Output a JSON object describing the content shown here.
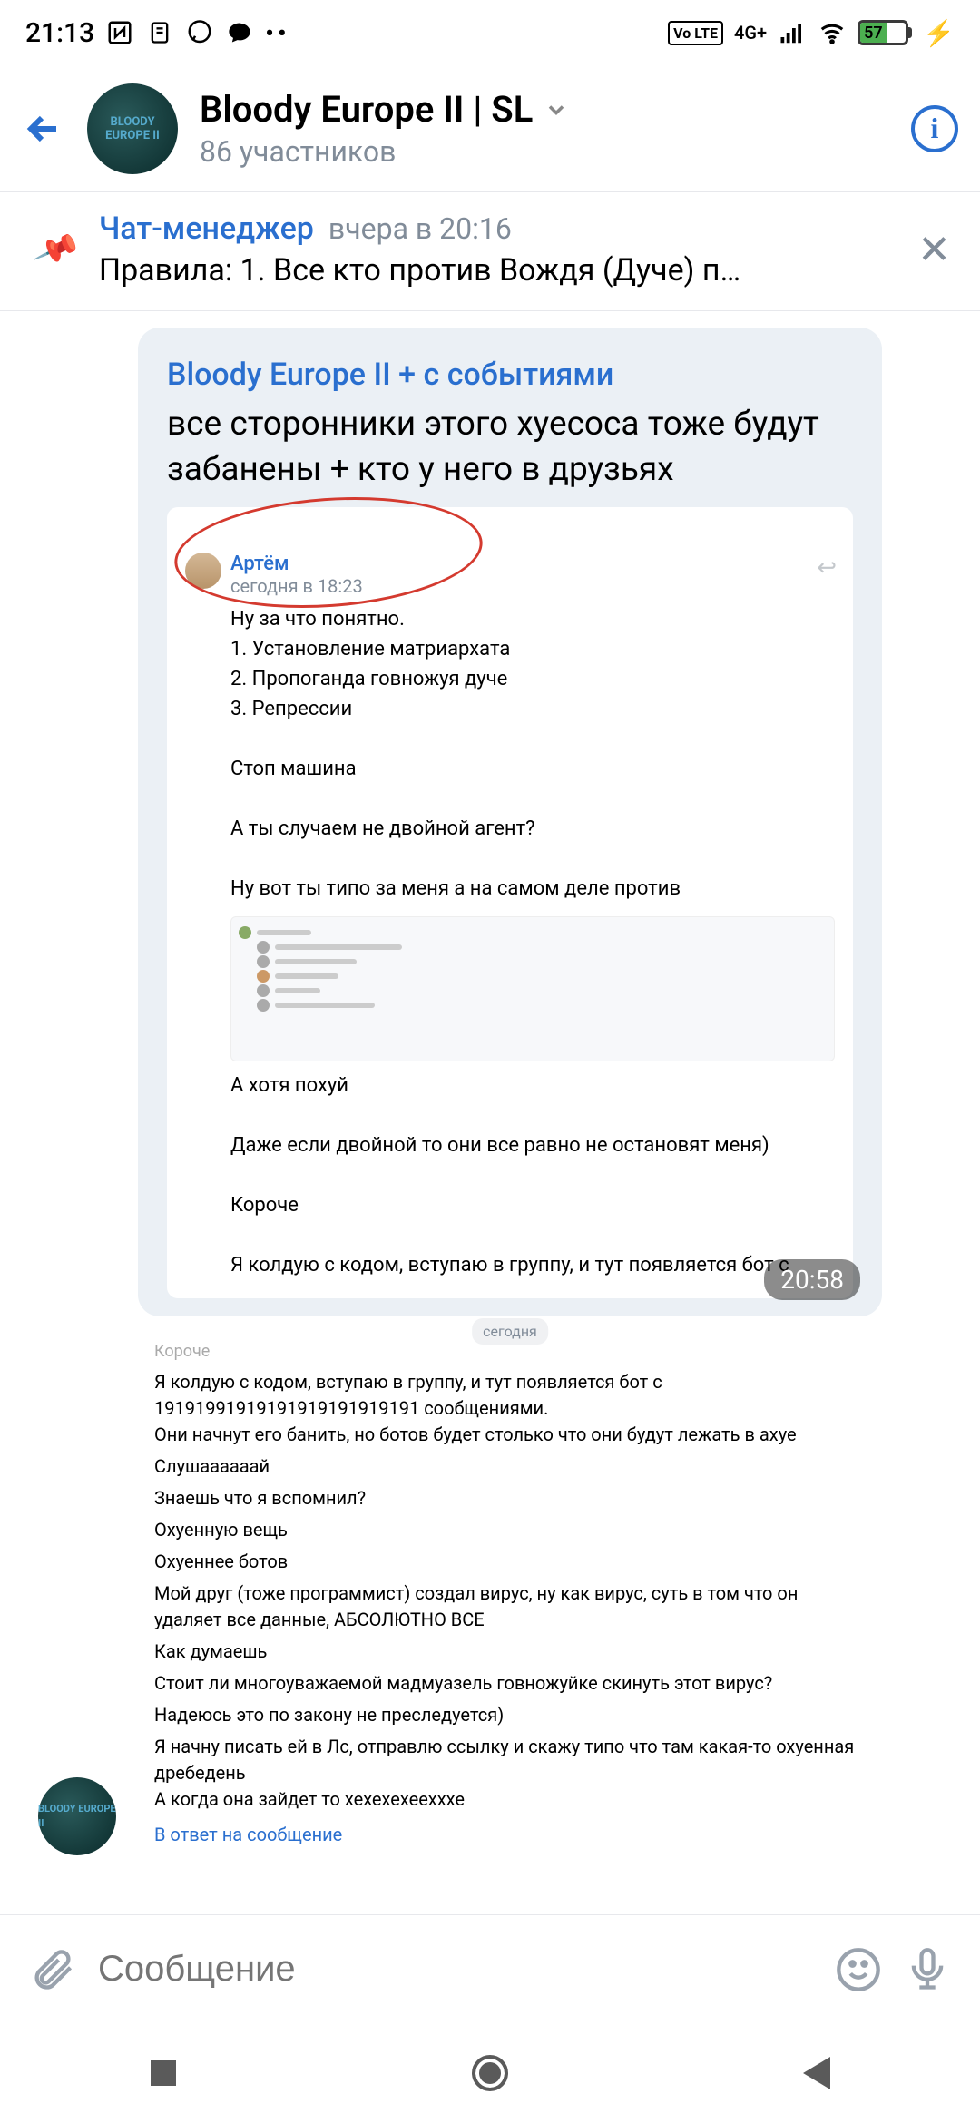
{
  "status": {
    "time": "21:13",
    "volte": "Vo LTE",
    "network": "4G+",
    "battery_pct": "57"
  },
  "header": {
    "title": "Bloody Europe II | SL",
    "subtitle": "86 участников",
    "avatar_text": "BLOODY EUROPE II"
  },
  "pinned": {
    "author": "Чат-менеджер",
    "time": "вчера в 20:16",
    "text": "Правила: 1. Все кто против Вождя (Дуче) п…"
  },
  "message1": {
    "reply_source": "Bloody Europe II + с событиями",
    "reply_text": "все сторонники этого хуесоса тоже будут забанены + кто у него в друзьях",
    "inner_name": "Артём",
    "inner_time": "сегодня в 18:23",
    "inner_text_top": "Ну за что понятно.\n1. Установление матриархата\n2. Пропоганда говножуя дуче\n3. Репрессии\n\nСтоп машина\n\nА ты случаем не двойной агент?\n\nНу вот ты типо за меня а на самом деле против",
    "inner_text_bottom": "А хотя похуй\n\nДаже если двойной то они все равно не остановят меня)\n\nКороче\n\nЯ колдую с кодом, вступаю в группу, и тут появляется бот с",
    "time": "20:58"
  },
  "message2": {
    "date": "сегодня",
    "top_cut": "Короче",
    "p1": "Я колдую с кодом, вступаю в группу, и тут появляется бот с 19191991919191919191919191 сообщениями.\nОни начнут его банить, но ботов будет столько что они будут лежать в ахуе",
    "p2": "Слушаааааай",
    "p3": "Знаешь что я вспомнил?",
    "p4": "Охуенную вещь",
    "p5": "Охуеннее ботов",
    "p6": "Мой друг (тоже программист) создал вирус, ну как вирус, суть в том что он удаляет все данные, АБСОЛЮТНО ВСЕ",
    "p7": "Как думаешь",
    "p8": "Стоит ли многоуважаемой мадмуазель говножуйке скинуть этот вирус?",
    "p9": "Надеюсь это по закону не преследуется)",
    "p10": "Я начну писать ей в Лс, отправлю ссылку и скажу типо что там какая-то охуенная дребедень\nА когда она зайдет то хехехехеехххе",
    "reply_link": "В ответ на сообщение"
  },
  "composer": {
    "placeholder": "Сообщение"
  }
}
